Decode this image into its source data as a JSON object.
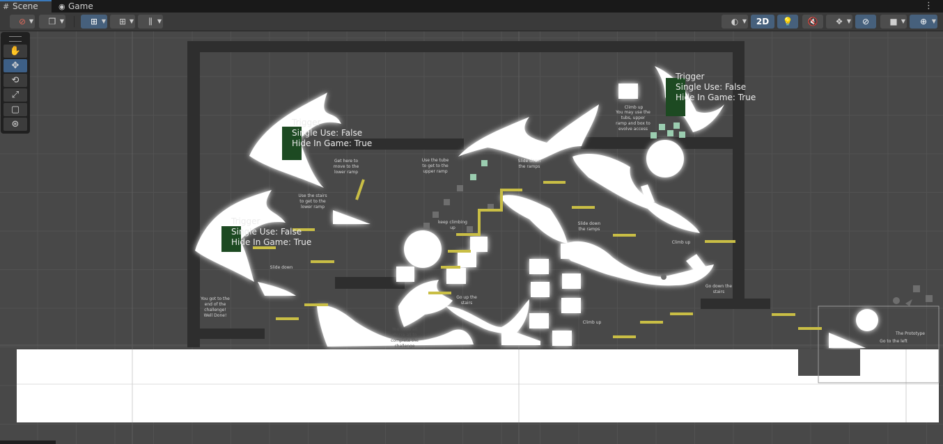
{
  "tabs": [
    {
      "label": "Scene",
      "icon": "grid-icon"
    },
    {
      "label": "Game",
      "icon": "gamepad-icon"
    }
  ],
  "toolbar": {
    "mode_2d": "2D"
  },
  "tools": [
    "hand-tool",
    "move-tool",
    "rotate-tool",
    "scale-tool",
    "rect-tool",
    "transform-tool"
  ],
  "triggers": [
    {
      "title": "Trigger",
      "single_use": "Single Use: False",
      "hide": "Hide In Game: True"
    },
    {
      "title": "Trigger",
      "single_use": "Single Use: False",
      "hide": "Hide In Game: True"
    },
    {
      "title": "Trigger",
      "single_use": "Single Use: False",
      "hide": "Hide In Game: True"
    }
  ],
  "labels": {
    "get_here": "Get here to move to the lower ramp",
    "use_tube": "Use the tube to get to the upper ramp",
    "slide_down_ramps_1": "Slide down the ramps",
    "climb_up_top": "Climb up",
    "climb_use": "You may use the tubs, upper ramp and box to evolve access",
    "use_stairs": "Use the stairs to get to the lower ramp",
    "keep_climbing": "keep climbing up",
    "slide_down_ramps_2": "Slide down the ramps",
    "climb_up_right": "Climb up",
    "slide_down": "Slide down",
    "end": "You got to the end of the challenge! Well Done!",
    "go_up_stairs": "Go up the stairs",
    "go_down_stairs": "Go down the stairs",
    "climb_up_bottom": "Climb up",
    "you_need": "You need all You're all to complete the challenge",
    "prototype": "The Prototype",
    "go_left": "Go to the left"
  },
  "colors": {
    "accent": "#3a79bb",
    "trigger": "#1d4a22",
    "platform": "#c9be45",
    "wall": "#2e2e2e",
    "tube": "#9bcdb0"
  }
}
